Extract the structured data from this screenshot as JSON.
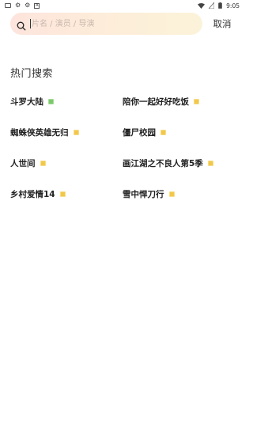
{
  "status_bar": {
    "left_icons": [
      "mail-icon",
      "bug-icon",
      "bug-icon",
      "a-icon"
    ],
    "right_icons": [
      "wifi-icon",
      "sim-icon",
      "battery-icon"
    ],
    "time": "9:05"
  },
  "search": {
    "placeholder": "片名 / 演员 / 导演",
    "value": "",
    "cancel_label": "取消"
  },
  "hot_search": {
    "title": "热门搜索",
    "items": [
      {
        "label": "斗罗大陆",
        "badge_color": "#7cc86a"
      },
      {
        "label": "陪你一起好好吃饭",
        "badge_color": "#f2c84a"
      },
      {
        "label": "蜘蛛侠英雄无归",
        "badge_color": "#f2c84a"
      },
      {
        "label": "僵尸校园",
        "badge_color": "#f2c84a"
      },
      {
        "label": "人世间",
        "badge_color": "#f2c84a"
      },
      {
        "label": "画江湖之不良人第5季",
        "badge_color": "#f2c84a"
      },
      {
        "label": "乡村爱情14",
        "badge_color": "#f2c84a"
      },
      {
        "label": "雪中悍刀行",
        "badge_color": "#f2c84a"
      }
    ]
  },
  "colors": {
    "search_gradient_start": "#fde4dd",
    "search_gradient_end": "#fbf3d9",
    "badge_green": "#7cc86a",
    "badge_yellow": "#f2c84a"
  }
}
